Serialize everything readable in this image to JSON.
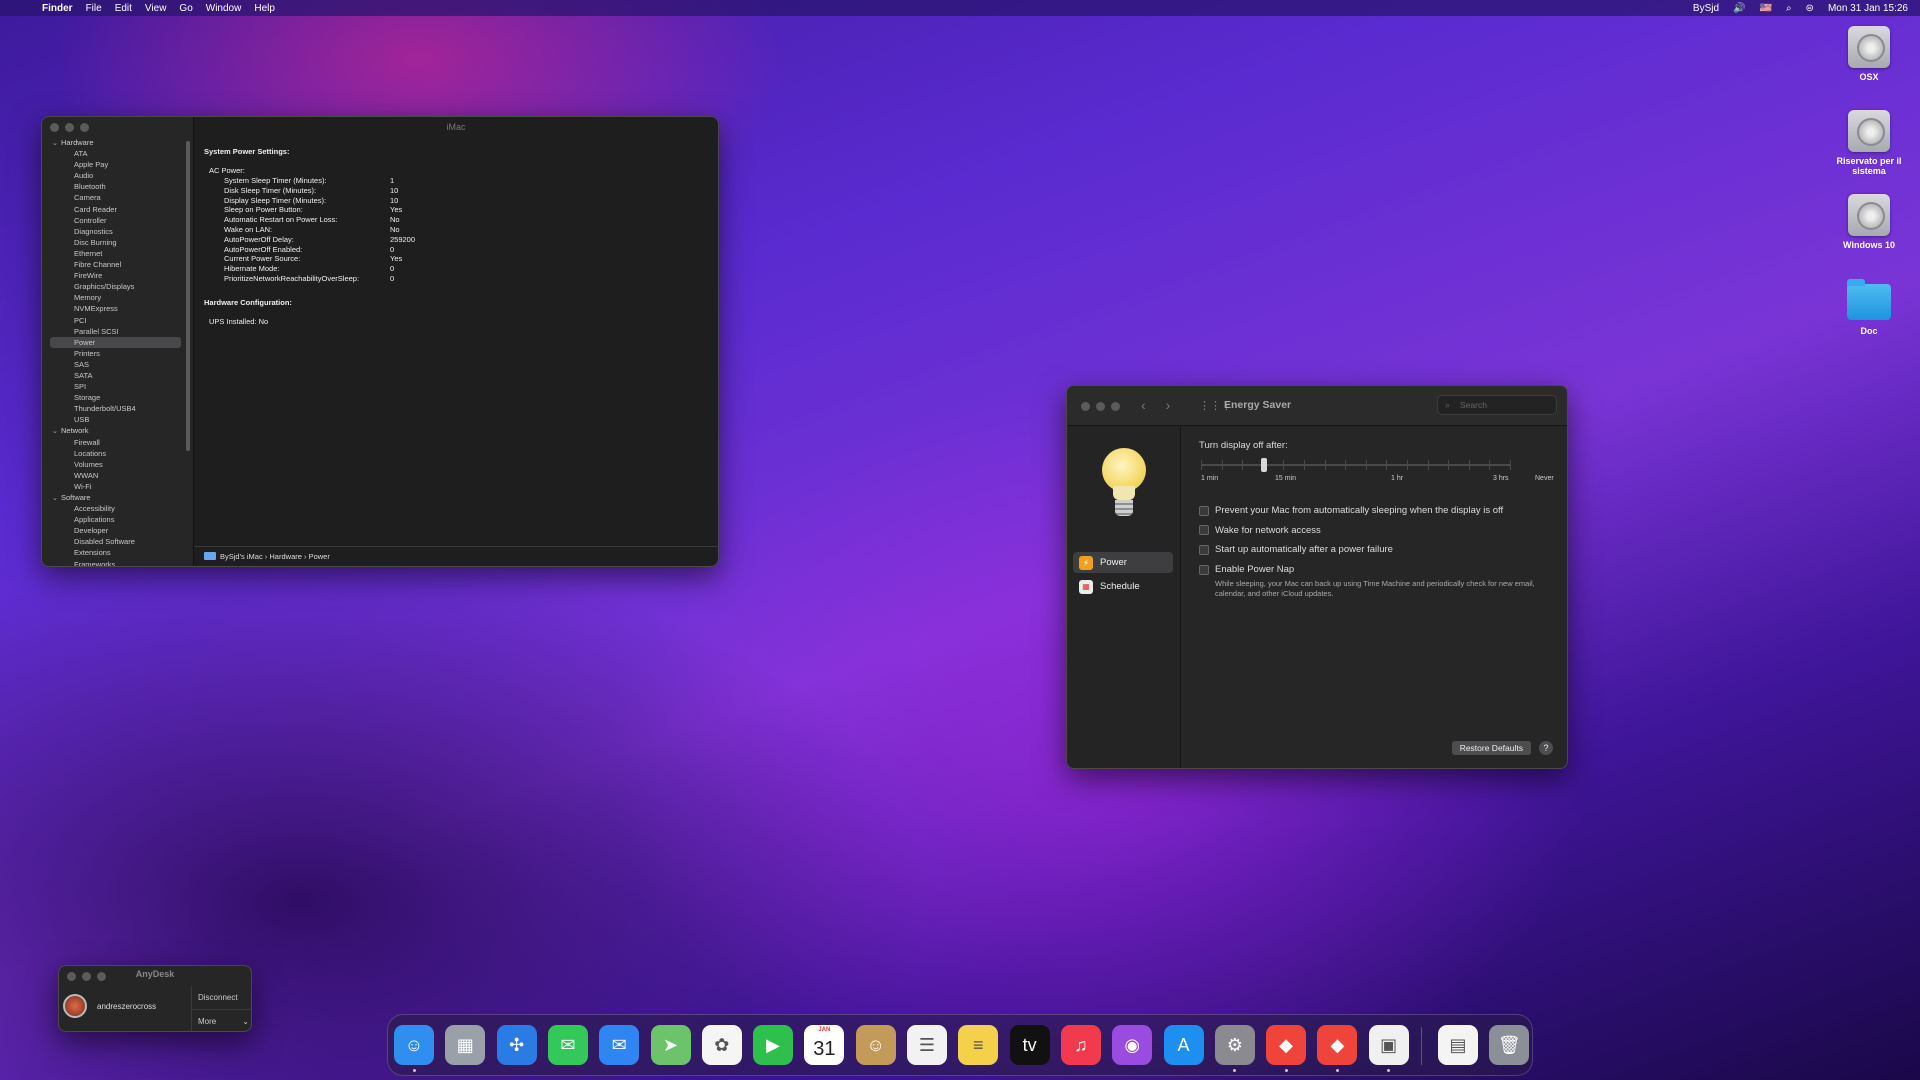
{
  "menubar": {
    "apple": "",
    "app": "Finder",
    "items": [
      "File",
      "Edit",
      "View",
      "Go",
      "Window",
      "Help"
    ],
    "user": "BySjd",
    "volume_icon": "speaker-icon",
    "volume_glyph": "🔊",
    "flag_icon": "us-flag-icon",
    "flag_glyph": "🇺🇸",
    "search_glyph": "⌕",
    "control_glyph": "⊜",
    "datetime": "Mon 31 Jan  15:26"
  },
  "desktop_icons": [
    {
      "label": "OSX",
      "kind": "drive"
    },
    {
      "label": "Riservato per il sistema",
      "kind": "drive"
    },
    {
      "label": "Windows 10",
      "kind": "drive"
    },
    {
      "label": "Doc",
      "kind": "folder"
    }
  ],
  "sysinfo": {
    "title": "iMac",
    "sidebar": {
      "groups": [
        {
          "label": "Hardware",
          "items": [
            "ATA",
            "Apple Pay",
            "Audio",
            "Bluetooth",
            "Camera",
            "Card Reader",
            "Controller",
            "Diagnostics",
            "Disc Burning",
            "Ethernet",
            "Fibre Channel",
            "FireWire",
            "Graphics/Displays",
            "Memory",
            "NVMExpress",
            "PCI",
            "Parallel SCSI",
            "Power",
            "Printers",
            "SAS",
            "SATA",
            "SPI",
            "Storage",
            "Thunderbolt/USB4",
            "USB"
          ]
        },
        {
          "label": "Network",
          "items": [
            "Firewall",
            "Locations",
            "Volumes",
            "WWAN",
            "Wi-Fi"
          ]
        },
        {
          "label": "Software",
          "items": [
            "Accessibility",
            "Applications",
            "Developer",
            "Disabled Software",
            "Extensions",
            "Frameworks"
          ]
        }
      ],
      "selected": "Power"
    },
    "content": {
      "heading": "System Power Settings:",
      "subhead": "AC Power:",
      "rows": [
        [
          "System Sleep Timer (Minutes):",
          "1"
        ],
        [
          "Disk Sleep Timer (Minutes):",
          "10"
        ],
        [
          "Display Sleep Timer (Minutes):",
          "10"
        ],
        [
          "Sleep on Power Button:",
          "Yes"
        ],
        [
          "Automatic Restart on Power Loss:",
          "No"
        ],
        [
          "Wake on LAN:",
          "No"
        ],
        [
          "AutoPowerOff Delay:",
          "259200"
        ],
        [
          "AutoPowerOff Enabled:",
          "0"
        ],
        [
          "Current Power Source:",
          "Yes"
        ],
        [
          "Hibernate Mode:",
          "0"
        ],
        [
          "PrioritizeNetworkReachabilityOverSleep:",
          "0"
        ]
      ],
      "heading2": "Hardware Configuration:",
      "ups": "UPS Installed:  No"
    },
    "path": [
      "BySjd's iMac",
      "Hardware",
      "Power"
    ],
    "path_sep": "›"
  },
  "energy": {
    "title": "Energy Saver",
    "back_glyph": "‹",
    "forward_glyph": "›",
    "grid_glyph": "⋮⋮⋮",
    "search_placeholder": "Search",
    "search_glyph": "⌕",
    "tabs": [
      {
        "label": "Power",
        "icon": "power-icon",
        "glyph": "⚡"
      },
      {
        "label": "Schedule",
        "icon": "schedule-icon",
        "glyph": "▦"
      }
    ],
    "slider_label": "Turn display off after:",
    "slider_scale": [
      "1 min",
      "15 min",
      "1 hr",
      "3 hrs",
      "Never"
    ],
    "slider_value_fraction": 0.2,
    "checks": [
      "Prevent your Mac from automatically sleeping when the display is off",
      "Wake for network access",
      "Start up automatically after a power failure",
      "Enable Power Nap"
    ],
    "power_nap_note": "While sleeping, your Mac can back up using Time Machine and periodically check for new email, calendar, and other iCloud updates.",
    "restore_label": "Restore Defaults",
    "help_label": "?"
  },
  "anydesk": {
    "title": "AnyDesk",
    "user": "andreszerocross",
    "disconnect": "Disconnect",
    "more": "More",
    "more_glyph": "⌄"
  },
  "dock": {
    "calendar_month": "JAN",
    "calendar_day": "31",
    "apps": [
      {
        "name": "Finder",
        "icon": "finder-icon",
        "glyph": "☺",
        "color": "#2f8ef0",
        "running": true
      },
      {
        "name": "Launchpad",
        "icon": "launchpad-icon",
        "glyph": "▦",
        "color": "#9aa0aa",
        "running": false
      },
      {
        "name": "Safari",
        "icon": "safari-icon",
        "glyph": "✣",
        "color": "#2a7be4",
        "running": false
      },
      {
        "name": "Messages",
        "icon": "messages-icon",
        "glyph": "✉",
        "color": "#34c759",
        "running": false
      },
      {
        "name": "Mail",
        "icon": "mail-icon",
        "glyph": "✉",
        "color": "#2f86f2",
        "running": false
      },
      {
        "name": "Maps",
        "icon": "maps-icon",
        "glyph": "➤",
        "color": "#6cc36b",
        "running": false
      },
      {
        "name": "Photos",
        "icon": "photos-icon",
        "glyph": "✿",
        "color": "#f5f5f5",
        "running": false
      },
      {
        "name": "FaceTime",
        "icon": "facetime-icon",
        "glyph": "▶",
        "color": "#2fbf4e",
        "running": false
      },
      {
        "name": "Calendar",
        "icon": "calendar-icon",
        "glyph": "",
        "color": "#ffffff",
        "running": false
      },
      {
        "name": "Contacts",
        "icon": "contacts-icon",
        "glyph": "☺",
        "color": "#c49a5a",
        "running": false
      },
      {
        "name": "Reminders",
        "icon": "reminders-icon",
        "glyph": "☰",
        "color": "#f2f2f2",
        "running": false
      },
      {
        "name": "Notes",
        "icon": "notes-icon",
        "glyph": "≡",
        "color": "#f5d04a",
        "running": false
      },
      {
        "name": "Apple TV",
        "icon": "apple-tv-icon",
        "glyph": "tv",
        "color": "#111111",
        "running": false
      },
      {
        "name": "Music",
        "icon": "music-icon",
        "glyph": "♫",
        "color": "#f23a4f",
        "running": false
      },
      {
        "name": "Podcasts",
        "icon": "podcasts-icon",
        "glyph": "◉",
        "color": "#9a4be0",
        "running": false
      },
      {
        "name": "App Store",
        "icon": "app-store-icon",
        "glyph": "A",
        "color": "#1d8ff0",
        "running": false
      },
      {
        "name": "System Preferences",
        "icon": "gear-icon",
        "glyph": "⚙",
        "color": "#8a8a90",
        "running": true
      },
      {
        "name": "AnyDesk",
        "icon": "anydesk-icon",
        "glyph": "◆",
        "color": "#ef443b",
        "running": true
      },
      {
        "name": "AnyDesk Session",
        "icon": "anydesk-session-icon",
        "glyph": "◆",
        "color": "#ef443b",
        "running": true
      },
      {
        "name": "System Information",
        "icon": "system-information-icon",
        "glyph": "▣",
        "color": "#f0f0f0",
        "running": true
      },
      {
        "name": "Document",
        "icon": "document-icon",
        "glyph": "▤",
        "color": "#f4f4f4",
        "running": false
      },
      {
        "name": "Trash",
        "icon": "trash-icon",
        "glyph": "🗑",
        "color": "#8b8f97",
        "running": false
      }
    ]
  }
}
